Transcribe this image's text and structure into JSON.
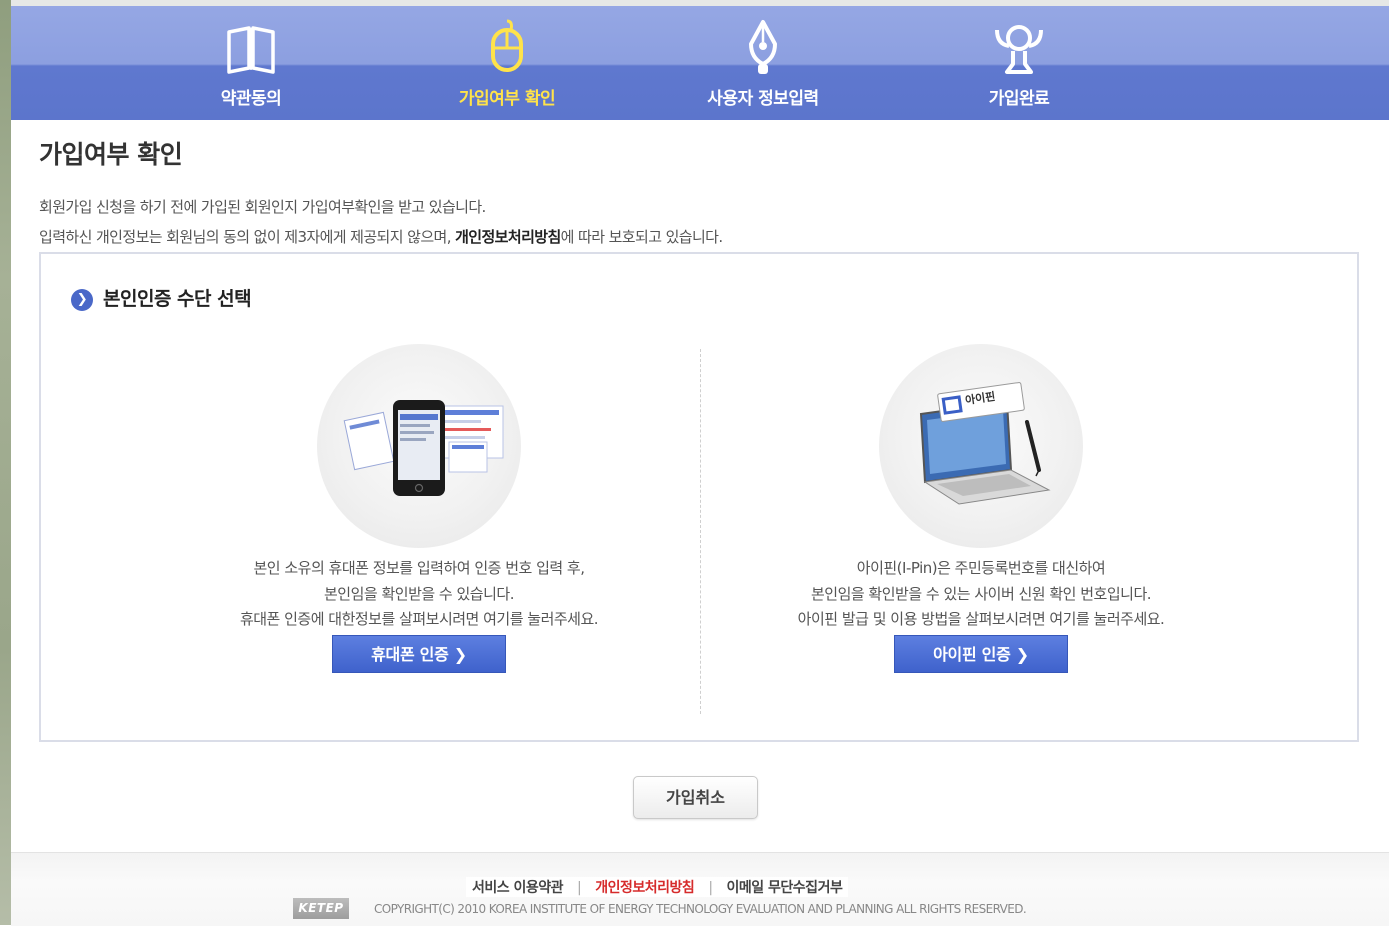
{
  "steps": [
    {
      "label": "약관동의",
      "icon": "book-icon",
      "active": false
    },
    {
      "label": "가입여부 확인",
      "icon": "mouse-icon",
      "active": true
    },
    {
      "label": "사용자 정보입력",
      "icon": "pen-nib-icon",
      "active": false
    },
    {
      "label": "가입완료",
      "icon": "trophy-icon",
      "active": false
    }
  ],
  "page": {
    "title": "가입여부 확인",
    "intro_line1": "회원가입 신청을 하기 전에 가입된 회원인지 가입여부확인을 받고 있습니다.",
    "intro_line2_pre": "입력하신 개인정보는 회원님의 동의 없이 제3자에게 제공되지 않으며, ",
    "intro_line2_bold": "개인정보처리방침",
    "intro_line2_post": "에 따라 보호되고 있습니다."
  },
  "auth": {
    "section_title": "본인인증 수단 선택",
    "phone": {
      "desc1": "본인 소유의 휴대폰 정보를 입력하여 인증 번호 입력 후,",
      "desc2": "본인임을 확인받을 수 있습니다.",
      "desc3": "휴대폰 인증에 대한정보를 살펴보시려면 여기를 눌러주세요.",
      "button": "휴대폰 인증 ❯",
      "image": "smartphone-illustration"
    },
    "ipin": {
      "desc1": "아이핀(I-Pin)은 주민등록번호를 대신하여",
      "desc2": "본인임을 확인받을 수 있는 사이버 신원 확인 번호입니다.",
      "desc3": "아이핀 발급 및 이용 방법을 살펴보시려면 여기를 눌러주세요.",
      "button": "아이핀 인증 ❯",
      "badge_text": "아이핀",
      "image": "laptop-ipin-illustration"
    }
  },
  "cancel_button": "가입취소",
  "footer": {
    "link_terms": "서비스 이용약관",
    "link_privacy": "개인정보처리방침",
    "link_email": "이메일 무단수집거부",
    "logo_text": "KETEP",
    "copyright": "COPYRIGHT(C) 2010 KOREA INSTITUTE OF ENERGY TECHNOLOGY EVALUATION AND PLANNING ALL RIGHTS RESERVED."
  },
  "colors": {
    "header_top": "#95a7e4",
    "header_bottom": "#5c75cc",
    "active_step": "#ffe34a",
    "button_blue": "#4a6bd4",
    "privacy_red": "#d62b2b"
  }
}
